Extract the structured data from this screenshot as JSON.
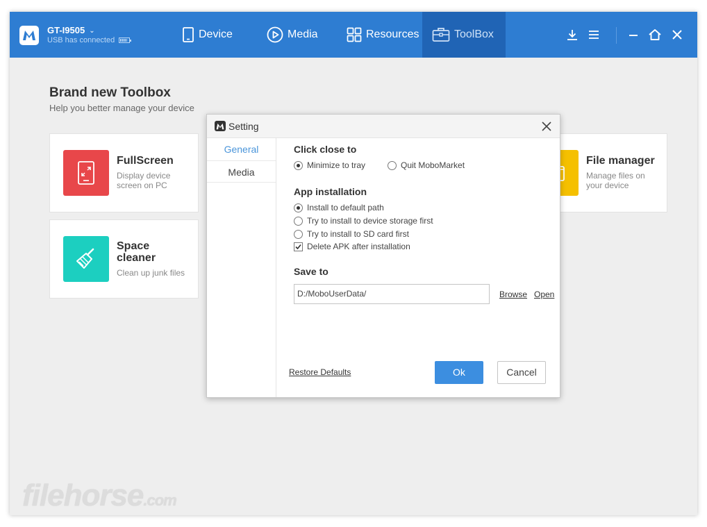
{
  "titlebar": {
    "device_name": "GT-I9505",
    "device_status": "USB has connected",
    "nav": [
      {
        "label": "Device",
        "icon": "phone-icon"
      },
      {
        "label": "Media",
        "icon": "play-icon"
      },
      {
        "label": "Resources",
        "icon": "grid-icon"
      },
      {
        "label": "ToolBox",
        "icon": "toolbox-icon",
        "active": true
      }
    ],
    "accent": "#2e7dd2",
    "active_tab_color": "#2064b5"
  },
  "page": {
    "title": "Brand new Toolbox",
    "subtitle": "Help you better manage your device"
  },
  "cards": [
    {
      "title": "FullScreen",
      "desc_line1": "Display device",
      "desc_line2": "screen on PC",
      "icon": "fullscreen-icon",
      "color": "#e8474a"
    },
    {
      "title_line1": "Space",
      "title_line2": "cleaner",
      "desc": "Clean up junk files",
      "icon": "broom-icon",
      "color": "#1ccfc0"
    },
    {
      "title": "File manager",
      "desc_line1": "Manage files on",
      "desc_line2": "your device",
      "icon": "folder-icon",
      "color": "#f5c000"
    }
  ],
  "dialog": {
    "title": "Setting",
    "sidebar": [
      "General",
      "Media"
    ],
    "click_close": {
      "title": "Click close to",
      "options": [
        "Minimize to tray",
        "Quit MoboMarket"
      ],
      "selected": 0
    },
    "app_install": {
      "title": "App installation",
      "options": [
        "Install to default path",
        "Try to install to device storage first",
        "Try to install to SD card first"
      ],
      "selected": 0,
      "delete_apk_label": "Delete APK after installation",
      "delete_apk_checked": true
    },
    "save_to": {
      "title": "Save to",
      "path": "D:/MoboUserData/",
      "browse": "Browse",
      "open": "Open"
    },
    "restore_defaults": "Restore Defaults",
    "ok": "Ok",
    "cancel": "Cancel"
  },
  "watermark": {
    "main": "filehorse",
    "suffix": ".com"
  }
}
